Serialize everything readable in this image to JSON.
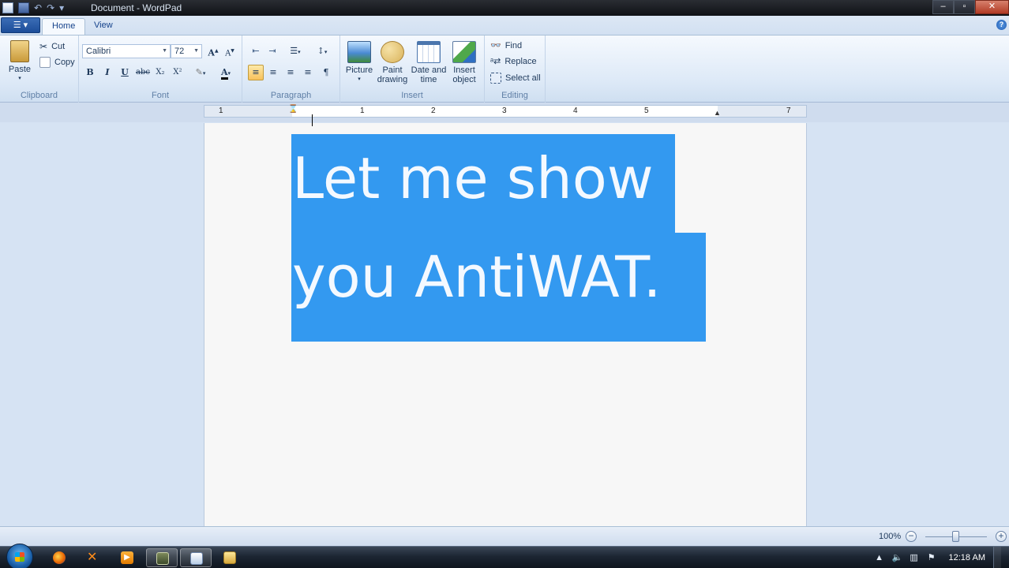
{
  "window": {
    "title": "Document - WordPad",
    "controls": [
      "minimize",
      "maximize",
      "close"
    ]
  },
  "tabs": [
    {
      "label": "Home",
      "active": true
    },
    {
      "label": "View",
      "active": false
    }
  ],
  "ribbon": {
    "clipboard": {
      "label": "Clipboard",
      "paste": "Paste",
      "cut": "Cut",
      "copy": "Copy"
    },
    "font": {
      "label": "Font",
      "family": "Calibri",
      "size": "72",
      "bold": "B",
      "italic": "I",
      "underline": "U",
      "strikethrough": "abc",
      "subscript": "X₂",
      "superscript": "X²"
    },
    "paragraph": {
      "label": "Paragraph",
      "alignment": "left"
    },
    "insert": {
      "label": "Insert",
      "picture": "Picture",
      "paint_drawing_1": "Paint",
      "paint_drawing_2": "drawing",
      "date_time_1": "Date and",
      "date_time_2": "time",
      "insert_object_1": "Insert",
      "insert_object_2": "object"
    },
    "editing": {
      "label": "Editing",
      "find": "Find",
      "replace": "Replace",
      "select_all": "Select all"
    }
  },
  "ruler": {
    "numbers": [
      "1",
      "1",
      "2",
      "3",
      "4",
      "5",
      "7"
    ]
  },
  "document": {
    "line1": "Let me show",
    "line2": "you AntiWAT.",
    "selected": true
  },
  "status": {
    "zoom": "100%",
    "zoom_level": 1.0
  },
  "taskbar": {
    "clock": "12:18 AM",
    "apps": [
      "firefox",
      "xmind",
      "media-player",
      "program",
      "wordpad",
      "explorer"
    ]
  },
  "colors": {
    "selection": "#3399f0",
    "selected_text": "#f4f9ff",
    "ribbon_bg": "#dde9f7"
  }
}
